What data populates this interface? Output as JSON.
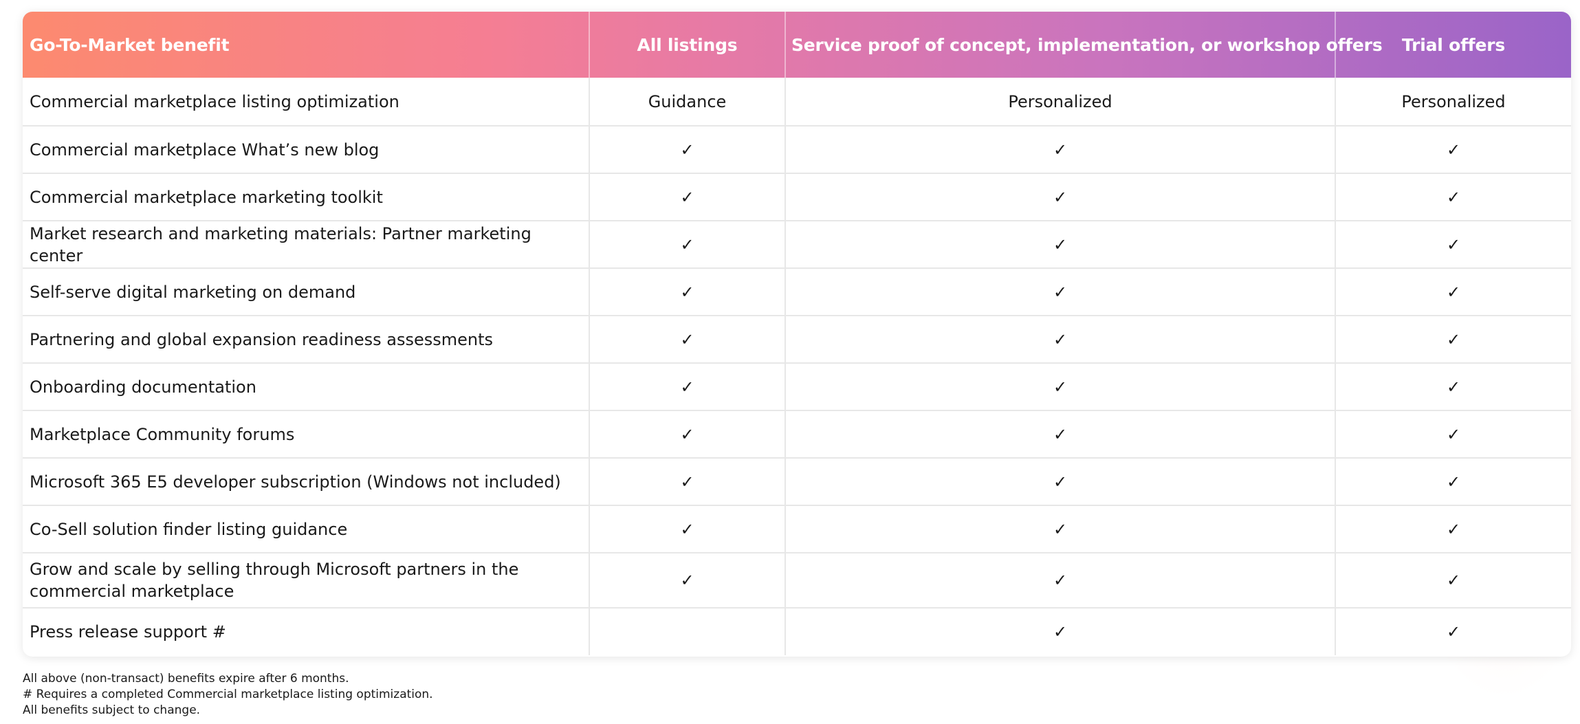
{
  "table": {
    "headers": [
      "Go-To-Market benefit",
      "All listings",
      "Service proof of concept, implementation, or workshop offers",
      "Trial offers"
    ],
    "rows": [
      [
        "Commercial marketplace listing optimization",
        "Guidance",
        "Personalized",
        "Personalized"
      ],
      [
        "Commercial marketplace What’s new blog",
        "✓",
        "✓",
        "✓"
      ],
      [
        "Commercial marketplace marketing toolkit",
        "✓",
        "✓",
        "✓"
      ],
      [
        "Market research and marketing materials: Partner marketing center",
        "✓",
        "✓",
        "✓"
      ],
      [
        "Self-serve digital marketing on demand",
        "✓",
        "✓",
        "✓"
      ],
      [
        "Partnering and global expansion readiness assessments",
        "✓",
        "✓",
        "✓"
      ],
      [
        "Onboarding documentation",
        "✓",
        "✓",
        "✓"
      ],
      [
        "Marketplace Community forums",
        "✓",
        "✓",
        "✓"
      ],
      [
        "Microsoft 365 E5 developer subscription (Windows not included)",
        "✓",
        "✓",
        "✓"
      ],
      [
        "Co-Sell solution finder listing guidance",
        "✓",
        "✓",
        "✓"
      ],
      [
        "Grow and scale by selling through Microsoft partners in the commercial marketplace",
        "✓",
        "✓",
        "✓"
      ],
      [
        "Press release support #",
        "",
        "✓",
        "✓"
      ]
    ]
  },
  "footnotes": [
    "All above (non-transact) benefits expire after 6 months.",
    "# Requires a completed Commercial marketplace listing optimization.",
    "All benefits subject to change."
  ],
  "colors": {
    "header_gradient_start": "#fc8a6f",
    "header_gradient_end": "#9a64c8",
    "grid_line": "#e7e7e7"
  }
}
